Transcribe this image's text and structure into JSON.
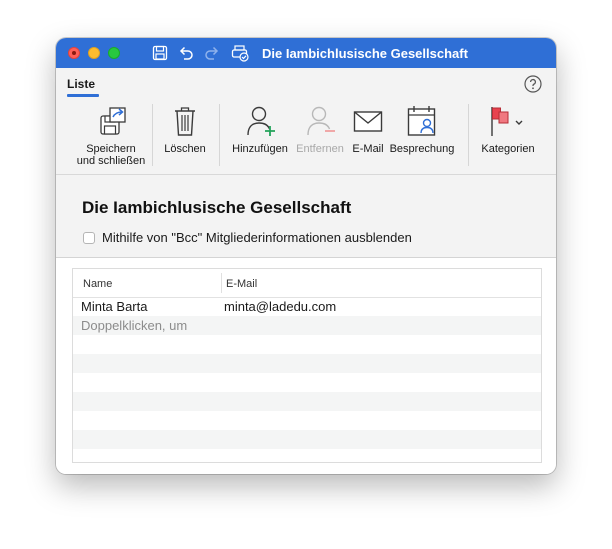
{
  "window": {
    "title": "Die Iambichlusische Gesellschaft"
  },
  "ribbon": {
    "tab": "Liste",
    "buttons": {
      "save_close": {
        "line1": "Speichern",
        "line2": "und schließen"
      },
      "delete": "Löschen",
      "add": "Hinzufügen",
      "remove": "Entfernen",
      "email": "E-Mail",
      "meeting": "Besprechung",
      "categories": "Kategorien"
    }
  },
  "group": {
    "name": "Die Iambichlusische Gesellschaft",
    "bcc_checkbox_label": "Mithilfe von \"Bcc\" Mitgliederinformationen ausblenden",
    "bcc_checked": false
  },
  "members_table": {
    "columns": [
      "Name",
      "E-Mail"
    ],
    "rows": [
      {
        "name": "Minta Barta",
        "email": "minta@ladedu.com"
      }
    ],
    "add_hint": "Doppelklicken, um"
  },
  "colors": {
    "titlebar": "#2f6fd6",
    "accent_green": "#22a35a",
    "flag_red": "#e8424f"
  }
}
